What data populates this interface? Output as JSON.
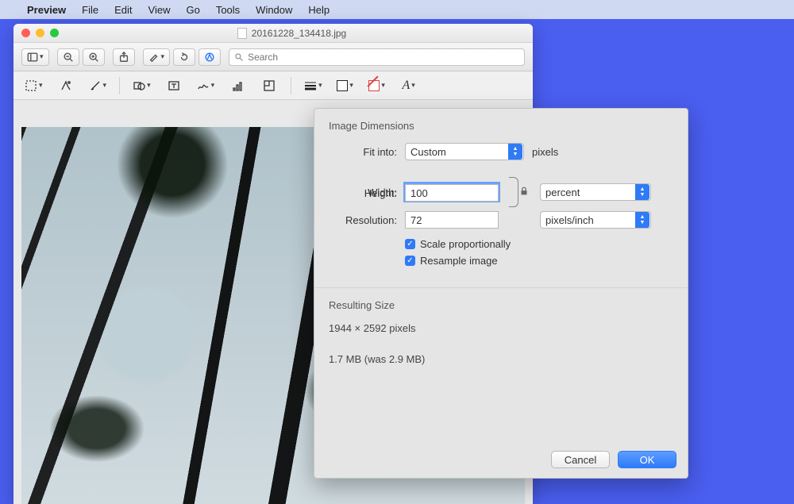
{
  "menubar": {
    "app": "Preview",
    "items": [
      "File",
      "Edit",
      "View",
      "Go",
      "Tools",
      "Window",
      "Help"
    ]
  },
  "window": {
    "title": "20161228_134418.jpg",
    "search_placeholder": "Search"
  },
  "dialog": {
    "section1_title": "Image Dimensions",
    "fit_label": "Fit into:",
    "fit_value": "Custom",
    "fit_unit": "pixels",
    "width_label": "Width:",
    "width_value": "100",
    "height_label": "Height:",
    "height_value": "100",
    "wh_unit": "percent",
    "resolution_label": "Resolution:",
    "resolution_value": "72",
    "resolution_unit": "pixels/inch",
    "scale_label": "Scale proportionally",
    "resample_label": "Resample image",
    "section2_title": "Resulting Size",
    "result_dims": "1944 × 2592 pixels",
    "result_size": "1.7 MB (was 2.9 MB)",
    "cancel": "Cancel",
    "ok": "OK"
  }
}
